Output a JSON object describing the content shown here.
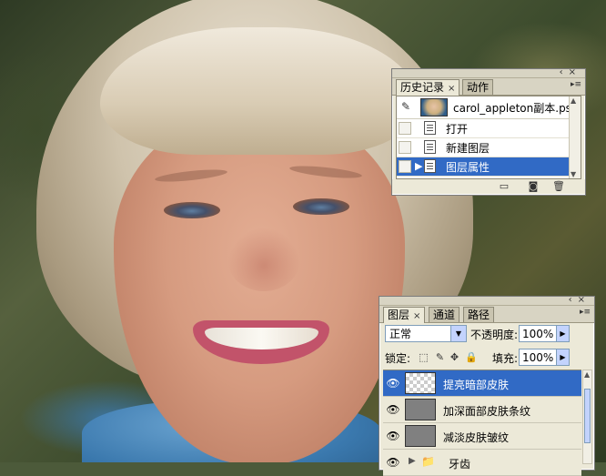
{
  "history_panel": {
    "tabs": [
      {
        "label": "历史记录",
        "active": true
      },
      {
        "label": "动作",
        "active": false
      }
    ],
    "close_glyph": "×",
    "snapshot_label": "carol_appleton副本.psd",
    "states": [
      {
        "label": "打开",
        "selected": false
      },
      {
        "label": "新建图层",
        "selected": false
      },
      {
        "label": "图层属性",
        "selected": true
      }
    ],
    "footer_icons": [
      "new-document-from-state-icon",
      "new-snapshot-icon",
      "delete-state-icon"
    ]
  },
  "layers_panel": {
    "tabs": [
      {
        "label": "图层",
        "active": true
      },
      {
        "label": "通道",
        "active": false
      },
      {
        "label": "路径",
        "active": false
      }
    ],
    "close_glyph": "×",
    "blend_mode": "正常",
    "opacity_label": "不透明度:",
    "opacity_value": "100%",
    "lock_label": "锁定:",
    "fill_label": "填充:",
    "fill_value": "100%",
    "layers": [
      {
        "name": "提亮暗部皮肤",
        "selected": true,
        "thumb": "transparent"
      },
      {
        "name": "加深面部皮肤条纹",
        "selected": false,
        "thumb": "gray"
      },
      {
        "name": "减淡皮肤皱纹",
        "selected": false,
        "thumb": "gray"
      },
      {
        "name": "牙齿",
        "selected": false,
        "thumb": "group"
      }
    ]
  },
  "colors": {
    "panel_bg": "#ece9d8",
    "selection": "#316ac5",
    "field_border": "#7f9db9"
  }
}
